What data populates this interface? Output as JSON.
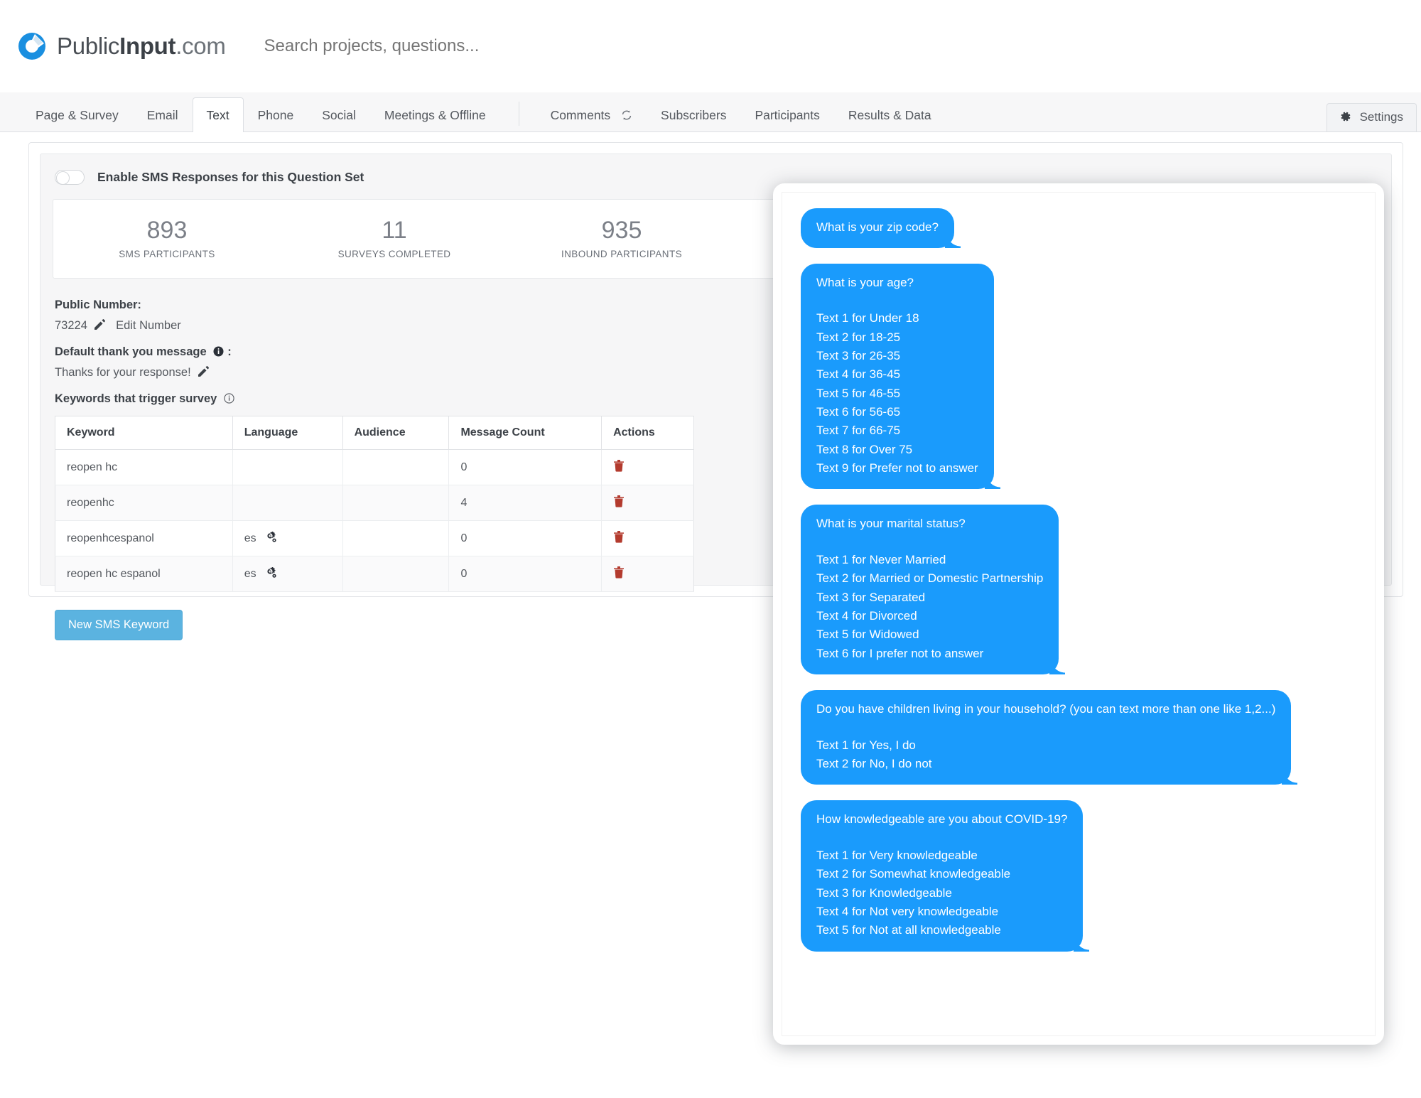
{
  "header": {
    "brand_pre": "Public",
    "brand_bold": "Input",
    "brand_suffix": ".com",
    "logo_icon": "publicinput-circle-logo",
    "search_placeholder": "Search projects, questions..."
  },
  "tabs": {
    "left": [
      {
        "label": "Page & Survey",
        "active": false
      },
      {
        "label": "Email",
        "active": false
      },
      {
        "label": "Text",
        "active": true
      },
      {
        "label": "Phone",
        "active": false
      },
      {
        "label": "Social",
        "active": false
      },
      {
        "label": "Meetings & Offline",
        "active": false
      }
    ],
    "right": [
      {
        "label": "Comments",
        "icon": "refresh-icon"
      },
      {
        "label": "Subscribers",
        "icon": ""
      },
      {
        "label": "Participants",
        "icon": ""
      },
      {
        "label": "Results & Data",
        "icon": ""
      }
    ],
    "settings_label": "Settings",
    "settings_icon": "gear-icon"
  },
  "sms_panel": {
    "enable_toggle_label": "Enable SMS Responses for this Question Set",
    "enable_toggle_state": "off",
    "stats": [
      {
        "value": "893",
        "label": "SMS PARTICIPANTS"
      },
      {
        "value": "11",
        "label": "SURVEYS COMPLETED"
      },
      {
        "value": "935",
        "label": "INBOUND PARTICIPANTS"
      }
    ],
    "public_number_label": "Public Number:",
    "public_number_value": "73224",
    "public_number_edit_icon": "edit-icon",
    "public_number_edit_link": "Edit Number",
    "thank_you_label": "Default thank you message",
    "thank_you_label_suffix": ":",
    "thank_you_info_icon": "info-filled-icon",
    "thank_you_value": "Thanks for your response!",
    "thank_you_edit_icon": "edit-icon",
    "keywords_label": "Keywords that trigger survey",
    "keywords_info_icon": "info-outline-icon",
    "table": {
      "columns": [
        "Keyword",
        "Language",
        "Audience",
        "Message Count",
        "Actions"
      ],
      "rows": [
        {
          "keyword": "reopen hc",
          "language": "",
          "lang_icon": "",
          "audience": "",
          "count": "0",
          "action_icon": "trash-icon"
        },
        {
          "keyword": "reopenhc",
          "language": "",
          "lang_icon": "",
          "audience": "",
          "count": "4",
          "action_icon": "trash-icon"
        },
        {
          "keyword": "reopenhcespanol",
          "language": "es",
          "lang_icon": "gears-icon",
          "audience": "",
          "count": "0",
          "action_icon": "trash-icon"
        },
        {
          "keyword": "reopen hc espanol",
          "language": "es",
          "lang_icon": "gears-icon",
          "audience": "",
          "count": "0",
          "action_icon": "trash-icon"
        }
      ]
    },
    "new_keyword_button": "New SMS Keyword"
  },
  "sms_preview": {
    "bubble_color": "#1a9bfc",
    "messages": [
      {
        "question": "What is your zip code?",
        "options": []
      },
      {
        "question": "What is your age?",
        "options": [
          "Text 1 for Under 18",
          "Text 2 for 18-25",
          "Text 3 for 26-35",
          "Text 4 for 36-45",
          "Text 5 for 46-55",
          "Text 6 for 56-65",
          "Text 7 for 66-75",
          "Text 8 for Over 75",
          "Text 9 for Prefer not to answer"
        ]
      },
      {
        "question": "What is your marital status?",
        "options": [
          "Text 1 for Never Married",
          "Text 2 for Married or Domestic Partnership",
          "Text 3 for Separated",
          "Text 4 for Divorced",
          "Text 5 for Widowed",
          "Text 6 for I prefer not to answer"
        ]
      },
      {
        "question": "Do you have children living in your household? (you can text more than one like 1,2...)",
        "options": [
          "Text 1 for Yes, I do",
          "Text 2 for No, I do not"
        ]
      },
      {
        "question": "How knowledgeable are you about COVID-19?",
        "options": [
          "Text 1 for Very knowledgeable",
          "Text 2 for Somewhat knowledgeable",
          "Text 3 for Knowledgeable",
          "Text 4 for Not very knowledgeable",
          "Text 5 for Not at all knowledgeable"
        ]
      }
    ]
  }
}
